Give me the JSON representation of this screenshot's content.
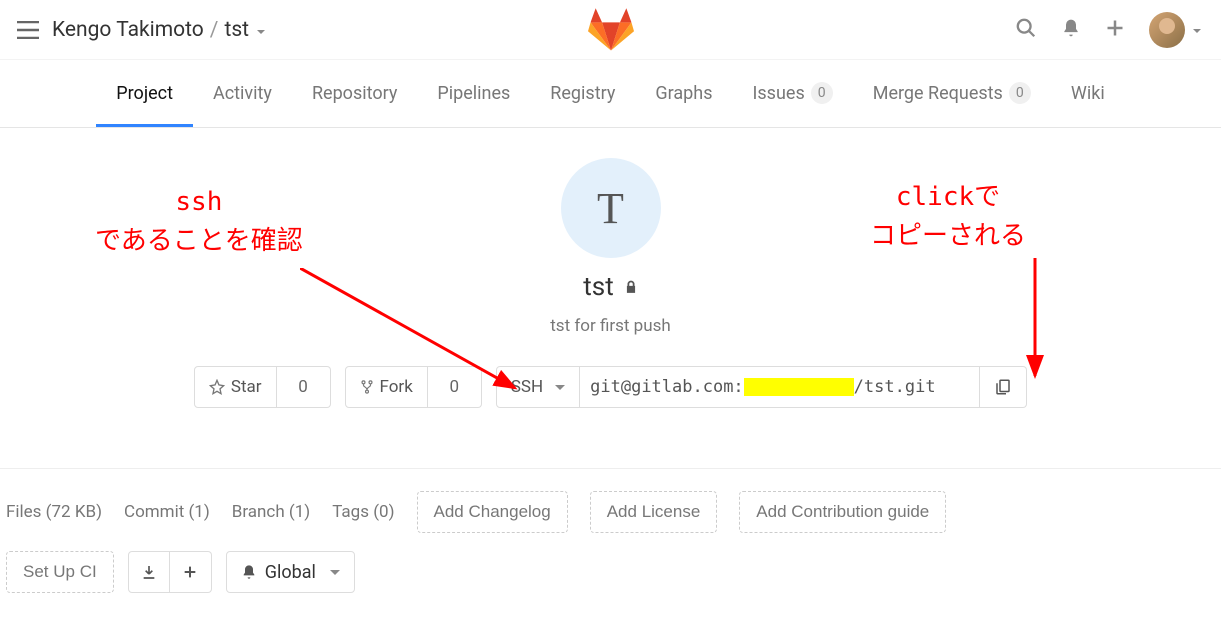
{
  "header": {
    "owner": "Kengo Takimoto",
    "project": "tst"
  },
  "nav": {
    "project": "Project",
    "activity": "Activity",
    "repository": "Repository",
    "pipelines": "Pipelines",
    "registry": "Registry",
    "graphs": "Graphs",
    "issues": "Issues",
    "issues_count": "0",
    "merge_requests": "Merge Requests",
    "mr_count": "0",
    "wiki": "Wiki"
  },
  "project_header": {
    "avatar_letter": "T",
    "name": "tst",
    "description": "tst for first push"
  },
  "actions": {
    "star": "Star",
    "star_count": "0",
    "fork": "Fork",
    "fork_count": "0",
    "clone_protocol": "SSH",
    "clone_prefix": "git@gitlab.com:",
    "clone_suffix": "/tst.git"
  },
  "stats": {
    "files": "Files (72 KB)",
    "commit": "Commit (1)",
    "branch": "Branch (1)",
    "tags": "Tags (0)",
    "add_changelog": "Add Changelog",
    "add_license": "Add License",
    "add_contrib": "Add Contribution guide",
    "setup_ci": "Set Up CI",
    "notification": "Global"
  },
  "annotations": {
    "left": "ssh\nであることを確認",
    "right": "clickで\nコピーされる"
  }
}
